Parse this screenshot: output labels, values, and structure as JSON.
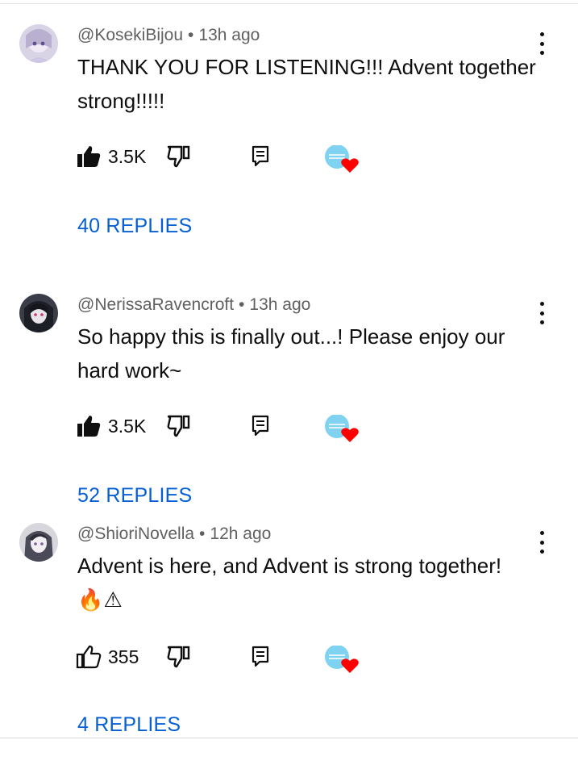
{
  "colors": {
    "link": "#065fd4",
    "meta": "#606060",
    "text": "#0f0f0f",
    "heart": "#ff0000",
    "creator_avatar": "#7fd3f0"
  },
  "comments": [
    {
      "author": "@KosekiBijou",
      "time": "13h ago",
      "text": "THANK YOU FOR LISTENING!!! Advent together strong!!!!!",
      "likes": "3.5K",
      "liked": true,
      "replies_label": "40 REPLIES"
    },
    {
      "author": "@NerissaRavencroft",
      "time": "13h ago",
      "text": "So happy this is finally out...! Please enjoy our hard work~",
      "likes": "3.5K",
      "liked": true,
      "replies_label": "52 REPLIES"
    },
    {
      "author": "@ShioriNovella",
      "time": "12h ago",
      "text": "Advent is here, and Advent is strong together!",
      "emoji": "🔥⚠",
      "likes": "355",
      "liked": false,
      "replies_label": "4 REPLIES"
    }
  ],
  "icons": {
    "like": "thumbs-up-icon",
    "dislike": "thumbs-down-icon",
    "reply": "reply-icon",
    "more": "more-vert-icon",
    "creator_heart": "creator-heart-icon"
  }
}
